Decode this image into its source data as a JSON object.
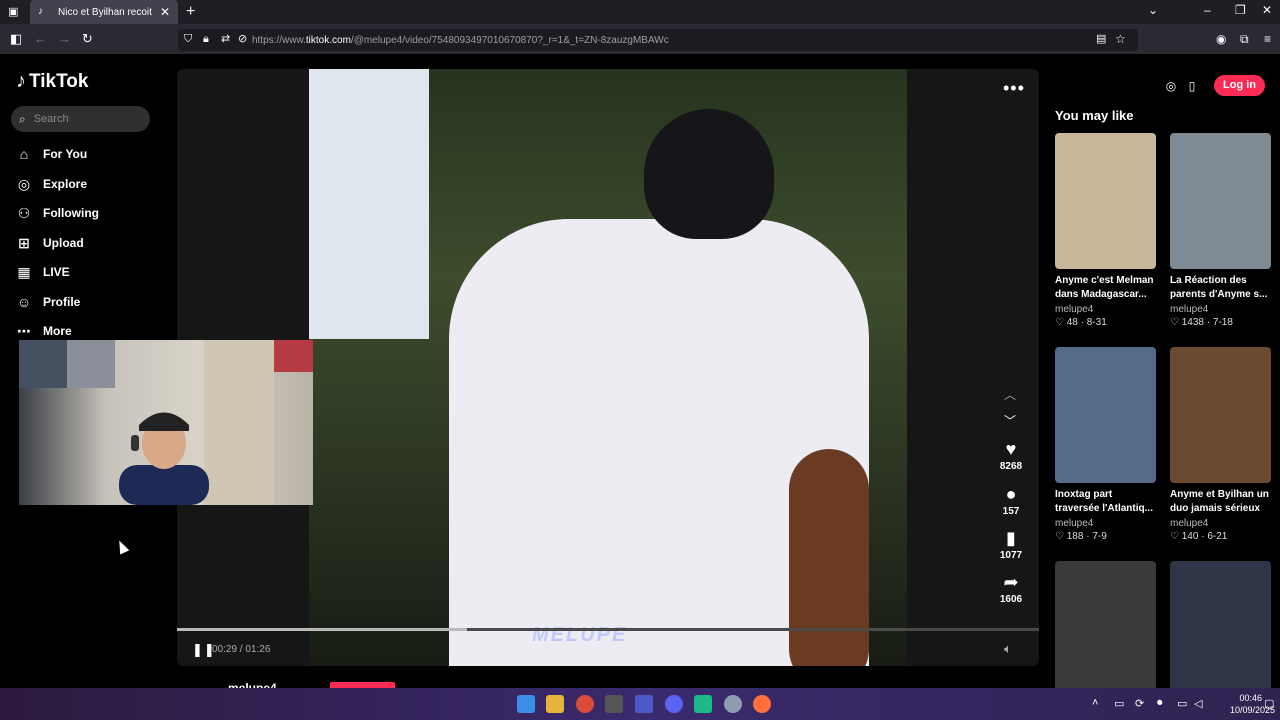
{
  "browser": {
    "tab_title": "Nico et Byilhan recoit un c",
    "url_prefix": "https://www.",
    "url_host": "tiktok.com",
    "url_path": "/@melupe4/video/7548093497010670870?_r=1&_t=ZN-8zauzgMBAWc"
  },
  "tiktok": {
    "brand": "TikTok",
    "search_placeholder": "Search",
    "nav": [
      {
        "label": "For You",
        "icon": "home-icon"
      },
      {
        "label": "Explore",
        "icon": "compass-icon"
      },
      {
        "label": "Following",
        "icon": "user-plus-icon"
      },
      {
        "label": "Upload",
        "icon": "plus-square-icon"
      },
      {
        "label": "LIVE",
        "icon": "live-icon"
      },
      {
        "label": "Profile",
        "icon": "user-icon"
      },
      {
        "label": "More",
        "icon": "more-icon"
      }
    ],
    "login_label": "Log in",
    "you_may_like": "You may like"
  },
  "video": {
    "watermark": "MELUPE",
    "actions": {
      "likes": "8268",
      "comments": "157",
      "saves": "1077",
      "shares": "1606"
    },
    "time": "00:29 / 01:26",
    "progress": 0.337,
    "author": "melupe4"
  },
  "recommendations": [
    {
      "caption": "Anyme c'est Melman dans Madagascar...",
      "author": "melupe4",
      "likes": "48",
      "date": "8-31",
      "color": "#c9b79b"
    },
    {
      "caption": "La Réaction des parents d'Anyme s...",
      "author": "melupe4",
      "likes": "1438",
      "date": "7-18",
      "color": "#7f8b94"
    },
    {
      "caption": "Inoxtag part traversée l'Atlantiq...",
      "author": "melupe4",
      "likes": "188",
      "date": "7-9",
      "color": "#566a8a"
    },
    {
      "caption": "Anyme et Byilhan un duo jamais sérieux ...",
      "author": "melupe4",
      "likes": "140",
      "date": "6-21",
      "color": "#6b4a30"
    },
    {
      "caption": "",
      "author": "",
      "likes": "",
      "date": "",
      "color": "#3a3a3a"
    },
    {
      "caption": "",
      "author": "",
      "likes": "",
      "date": "",
      "color": "#2e3547"
    }
  ],
  "taskbar": {
    "time": "00:46",
    "date": "10/09/2025"
  }
}
